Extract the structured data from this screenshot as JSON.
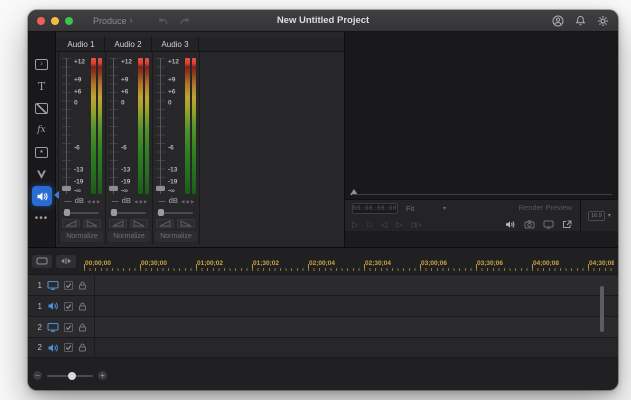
{
  "titlebar": {
    "produce_label": "Produce",
    "chevron": "›",
    "title": "New Untitled Project"
  },
  "icons": {
    "media_glyph": "♪",
    "text_glyph": "T",
    "fx_glyph": "fx",
    "sticker_glyph": "★",
    "more_glyph": "•••",
    "stepper_left": "◀",
    "stepper_diamond": "◆",
    "stepper_right": "▶",
    "dropdown_chevron": "▾",
    "zoom_minus": "−",
    "zoom_plus": "+"
  },
  "mixer": {
    "channels": [
      {
        "name": "Audio 1",
        "value": "—",
        "unit": "dB",
        "normalize": "Normalize"
      },
      {
        "name": "Audio 2",
        "value": "—",
        "unit": "dB",
        "normalize": "Normalize"
      },
      {
        "name": "Audio 3",
        "value": "—",
        "unit": "dB",
        "normalize": "Normalize"
      }
    ],
    "scale": [
      "+12",
      "+9",
      "+6",
      "0",
      "-6",
      "-13",
      "-19",
      "-∞"
    ]
  },
  "preview": {
    "timecode": "00:00:00:00",
    "fit": "Fit",
    "render_preview": "Render Preview",
    "aspect": "16:9",
    "transport": [
      "▷",
      "□",
      "◁",
      "▷",
      "▷▷"
    ]
  },
  "timeline": {
    "ruler": [
      "00;00;00",
      "00;30;00",
      "01;00;02",
      "01;30;02",
      "02;00;04",
      "02;30;04",
      "03;00;06",
      "03;30;06",
      "04;00;08",
      "04;30;08"
    ],
    "tracks": [
      {
        "number": "1",
        "type": "video"
      },
      {
        "number": "1",
        "type": "audio"
      },
      {
        "number": "2",
        "type": "video"
      },
      {
        "number": "2",
        "type": "audio"
      }
    ]
  },
  "colors": {
    "accent_blue": "#2a6cd5",
    "ruler_gold": "#cda43e",
    "track_icon_blue": "#4f8fd8",
    "meter_green": "#2f8122",
    "meter_red": "#d8402f",
    "traffic_red": "#f45f58",
    "traffic_yellow": "#f5bd3e",
    "traffic_green": "#37c648"
  }
}
